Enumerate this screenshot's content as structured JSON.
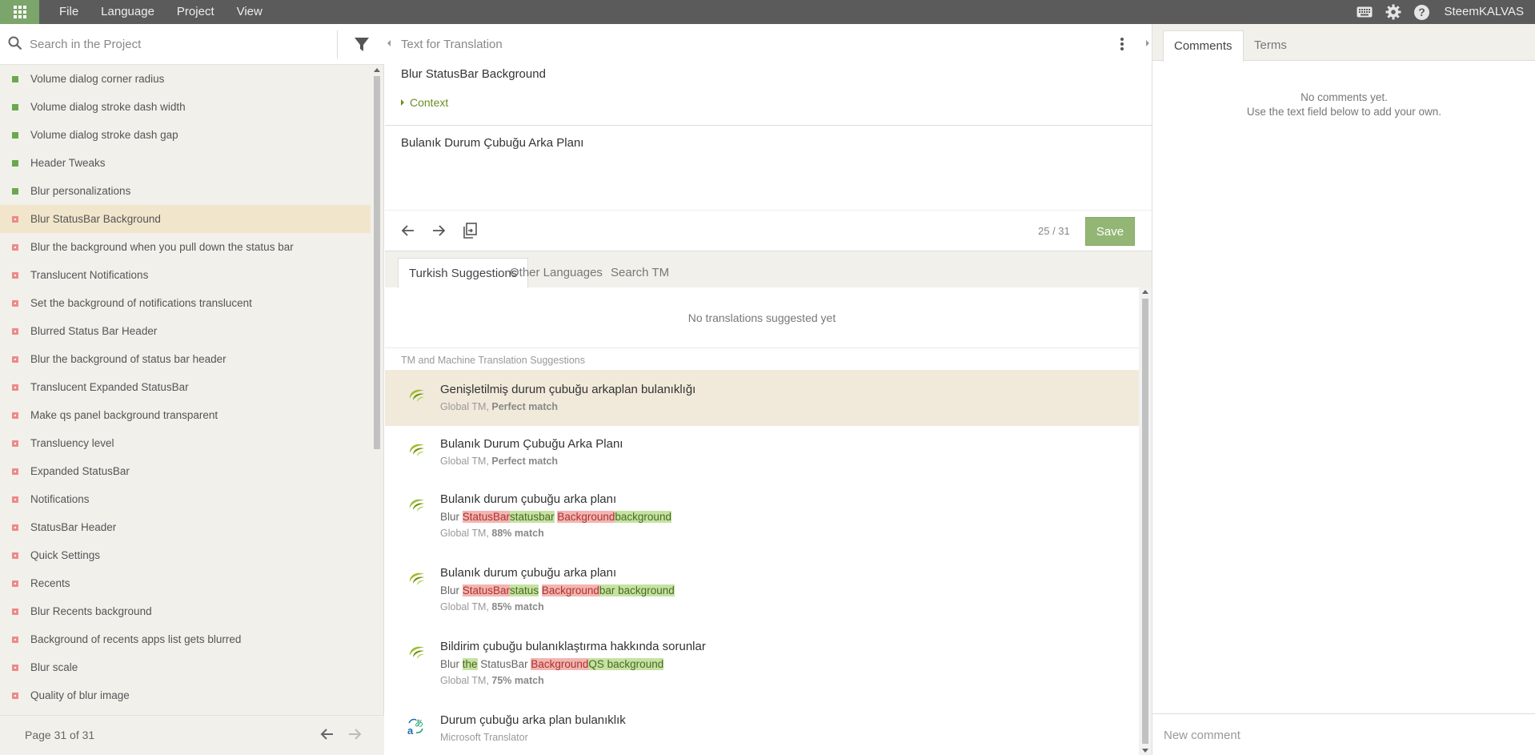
{
  "menu": {
    "items": [
      "File",
      "Language",
      "Project",
      "View"
    ],
    "username": "SteemKALVAS"
  },
  "left": {
    "search_placeholder": "Search in the Project",
    "items": [
      {
        "label": "Volume dialog corner radius",
        "status": "translated"
      },
      {
        "label": "Volume dialog stroke dash width",
        "status": "translated"
      },
      {
        "label": "Volume dialog stroke dash gap",
        "status": "translated"
      },
      {
        "label": "Header Tweaks",
        "status": "translated"
      },
      {
        "label": "Blur personalizations",
        "status": "translated"
      },
      {
        "label": "Blur StatusBar Background",
        "status": "untranslated",
        "selected": true
      },
      {
        "label": "Blur the background when you pull down the status bar",
        "status": "untranslated"
      },
      {
        "label": "Translucent Notifications",
        "status": "untranslated"
      },
      {
        "label": "Set the background of notifications translucent",
        "status": "untranslated"
      },
      {
        "label": "Blurred Status Bar Header",
        "status": "untranslated"
      },
      {
        "label": "Blur the background of status bar header",
        "status": "untranslated"
      },
      {
        "label": "Translucent Expanded StatusBar",
        "status": "untranslated"
      },
      {
        "label": "Make qs panel background transparent",
        "status": "untranslated"
      },
      {
        "label": "Transluency level",
        "status": "untranslated"
      },
      {
        "label": "Expanded StatusBar",
        "status": "untranslated"
      },
      {
        "label": "Notifications",
        "status": "untranslated"
      },
      {
        "label": "StatusBar Header",
        "status": "untranslated"
      },
      {
        "label": "Quick Settings",
        "status": "untranslated"
      },
      {
        "label": "Recents",
        "status": "untranslated"
      },
      {
        "label": "Blur Recents background",
        "status": "untranslated"
      },
      {
        "label": "Background of recents apps list gets blurred",
        "status": "untranslated"
      },
      {
        "label": "Blur scale",
        "status": "untranslated"
      },
      {
        "label": "Quality of blur image",
        "status": "untranslated"
      }
    ],
    "page_label": "Page 31 of 31"
  },
  "editor": {
    "header_label": "Text for Translation",
    "source_text": "Blur StatusBar Background",
    "context_label": "Context",
    "translation_value": "Bulanık Durum Çubuğu Arka Planı",
    "counter": "25 / 31",
    "save_label": "Save"
  },
  "suggestions": {
    "tabs": [
      "Turkish Suggestions",
      "Other Languages",
      "Search TM"
    ],
    "no_suggestions": "No translations suggested yet",
    "tm_heading": "TM and Machine Translation Suggestions",
    "items": [
      {
        "title": "Genişletilmiş durum çubuğu arkaplan bulanıklığı",
        "source": "Global TM",
        "match": "Perfect match",
        "highlight": true
      },
      {
        "title": "Bulanık Durum Çubuğu Arka Planı",
        "source": "Global TM",
        "match": "Perfect match"
      },
      {
        "title": "Bulanık durum çubuğu arka planı",
        "diff": [
          [
            "eq",
            "Blur "
          ],
          [
            "del",
            "StatusBar"
          ],
          [
            "ins",
            "statusbar"
          ],
          [
            "eq",
            " "
          ],
          [
            "del",
            "Background"
          ],
          [
            "ins",
            "background"
          ]
        ],
        "source": "Global TM",
        "match": "88% match"
      },
      {
        "title": "Bulanık durum çubuğu arka planı",
        "diff": [
          [
            "eq",
            "Blur "
          ],
          [
            "del",
            "StatusBar"
          ],
          [
            "ins",
            "status"
          ],
          [
            "eq",
            " "
          ],
          [
            "del",
            "Background"
          ],
          [
            "ins",
            "bar background"
          ]
        ],
        "source": "Global TM",
        "match": "85% match"
      },
      {
        "title": "Bildirim çubuğu bulanıklaştırma hakkında sorunlar",
        "diff": [
          [
            "eq",
            "Blur "
          ],
          [
            "ins",
            "the"
          ],
          [
            "eq",
            " StatusBar "
          ],
          [
            "del",
            "Background"
          ],
          [
            "ins",
            "QS background"
          ]
        ],
        "source": "Global TM",
        "match": "75% match"
      },
      {
        "title": "Durum çubuğu arka plan bulanıklık",
        "source": "Microsoft Translator",
        "icon": "translator"
      }
    ]
  },
  "right": {
    "tabs": [
      "Comments",
      "Terms"
    ],
    "no_comments_1": "No comments yet.",
    "no_comments_2": "Use the text field below to add your own.",
    "new_comment_placeholder": "New comment"
  },
  "colors": {
    "topbar": "#5b5b5b",
    "accent_green": "#7ba56b",
    "save_green": "#93b675",
    "selected_row": "#f1e6cc",
    "translated": "#6aa84f",
    "untranslated": "#ee8a8a"
  }
}
